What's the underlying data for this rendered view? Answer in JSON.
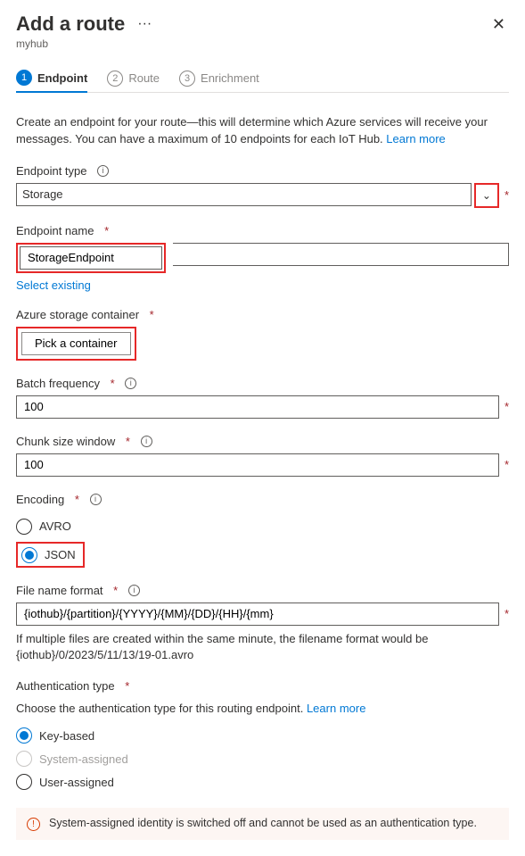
{
  "header": {
    "title": "Add a route",
    "subtitle": "myhub"
  },
  "steps": [
    {
      "num": "1",
      "label": "Endpoint",
      "active": true
    },
    {
      "num": "2",
      "label": "Route",
      "active": false
    },
    {
      "num": "3",
      "label": "Enrichment",
      "active": false
    }
  ],
  "intro": {
    "text": "Create an endpoint for your route—this will determine which Azure services will receive your messages. You can have a maximum of 10 endpoints for each IoT Hub. ",
    "link": "Learn more"
  },
  "fields": {
    "endpoint_type": {
      "label": "Endpoint type",
      "value": "Storage"
    },
    "endpoint_name": {
      "label": "Endpoint name",
      "value": "StorageEndpoint",
      "select_existing": "Select existing"
    },
    "container": {
      "label": "Azure storage container",
      "button": "Pick a container"
    },
    "batch": {
      "label": "Batch frequency",
      "value": "100"
    },
    "chunk": {
      "label": "Chunk size window",
      "value": "100"
    },
    "encoding": {
      "label": "Encoding",
      "options": [
        "AVRO",
        "JSON"
      ],
      "selected": "JSON"
    },
    "filename": {
      "label": "File name format",
      "value": "{iothub}/{partition}/{YYYY}/{MM}/{DD}/{HH}/{mm}",
      "note": "If multiple files are created within the same minute, the filename format would be {iothub}/0/2023/5/11/13/19-01.avro"
    },
    "auth": {
      "label": "Authentication type",
      "desc": "Choose the authentication type for this routing endpoint. ",
      "link": "Learn more",
      "options": [
        "Key-based",
        "System-assigned",
        "User-assigned"
      ],
      "selected": "Key-based",
      "disabled": "System-assigned"
    }
  },
  "warning": "System-assigned identity is switched off and cannot be used as an authentication type."
}
